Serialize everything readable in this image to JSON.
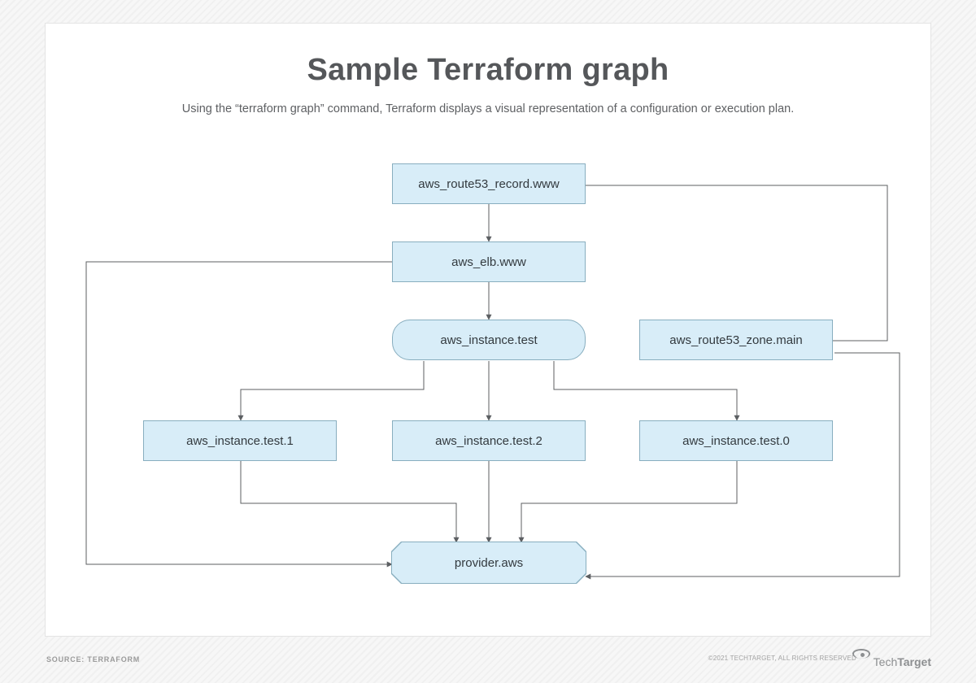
{
  "title": "Sample Terraform graph",
  "subtitle": "Using the “terraform graph” command, Terraform displays a visual representation of a configuration or execution plan.",
  "nodes": {
    "route53_record": "aws_route53_record.www",
    "elb": "aws_elb.www",
    "instance_test": "aws_instance.test",
    "route53_zone": "aws_route53_zone.main",
    "inst1": "aws_instance.test.1",
    "inst2": "aws_instance.test.2",
    "inst0": "aws_instance.test.0",
    "provider": "provider.aws"
  },
  "footer": {
    "source": "SOURCE: TERRAFORM",
    "copyright": "©2021 TECHTARGET, ALL RIGHTS RESERVED",
    "logo_a": "Tech",
    "logo_b": "Target"
  },
  "diagram_structure": {
    "description": "Terraform dependency graph with 5 tiers. Arrows indicate dependency (source depends on / points to target).",
    "edges": [
      {
        "from": "route53_record",
        "to": "elb"
      },
      {
        "from": "route53_record",
        "to": "route53_zone"
      },
      {
        "from": "elb",
        "to": "instance_test"
      },
      {
        "from": "elb",
        "to": "provider"
      },
      {
        "from": "instance_test",
        "to": "inst1"
      },
      {
        "from": "instance_test",
        "to": "inst2"
      },
      {
        "from": "instance_test",
        "to": "inst0"
      },
      {
        "from": "inst1",
        "to": "provider"
      },
      {
        "from": "inst2",
        "to": "provider"
      },
      {
        "from": "inst0",
        "to": "provider"
      },
      {
        "from": "route53_zone",
        "to": "provider"
      }
    ]
  }
}
